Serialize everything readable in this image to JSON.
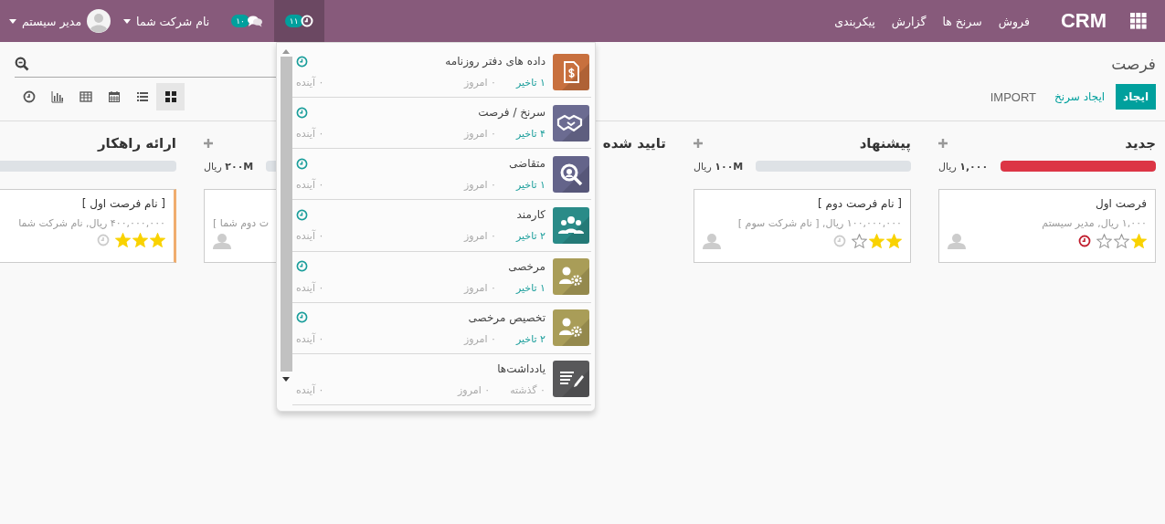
{
  "navbar": {
    "app_name": "CRM",
    "menus": [
      "فروش",
      "سرنخ ها",
      "گزارش",
      "پیکربندی"
    ],
    "user_name": "مدیر سیستم",
    "company": "نام شرکت شما",
    "messages_badge": "۱۰",
    "activities_badge": "۱۱",
    "activities_open": true
  },
  "control_panel": {
    "breadcrumb": "فرصت",
    "buttons": [
      {
        "label": "ایجاد",
        "kind": "primary"
      },
      {
        "label": "ایجاد سرنخ",
        "kind": "link"
      },
      {
        "label": "IMPORT",
        "kind": "secondary"
      }
    ],
    "views": [
      {
        "kind": "kanban",
        "selected": true
      },
      {
        "kind": "list",
        "selected": false
      },
      {
        "kind": "calendar",
        "selected": false
      },
      {
        "kind": "pivot",
        "selected": false
      },
      {
        "kind": "graph",
        "selected": false
      },
      {
        "kind": "activity",
        "selected": false
      }
    ]
  },
  "kanban": {
    "columns": [
      {
        "title": "جدید",
        "add_button": true,
        "total": "**۱,۰۰۰** ریال",
        "level": 1,
        "cards": [
          {
            "title": "فرصت اول",
            "subtitle": "۱,۰۰۰ ریال, مدیر سیستم",
            "stars": 1,
            "overdue": true,
            "avatar": true
          }
        ]
      },
      {
        "title": "پیشنهاد",
        "add_button": true,
        "total": "**۱۰۰M** ریال",
        "level": 0,
        "cards": [
          {
            "title": "[ نام فرصت دوم ]",
            "subtitle": "۱۰۰,۰۰۰,۰۰۰ ریال, [ نام شرکت سوم ]",
            "stars": 2,
            "overdue": false,
            "avatar": true
          }
        ]
      },
      {
        "title": "تایید شده",
        "add_button": false
      },
      {
        "add_button": true,
        "total": "**۲۰۰M** ریال",
        "level": 0,
        "covered": true,
        "cards": [
          {
            "subtitle": "ت دوم شما ]",
            "avatar": true
          }
        ]
      },
      {
        "title": "ارائه راهکار",
        "add_button": false,
        "level": 0,
        "cards": [
          {
            "title": "[ نام فرصت اول ]",
            "subtitle": "۴۰۰,۰۰۰,۰۰۰ ریال, نام شرکت شما",
            "stars": 3,
            "overdue": false,
            "avatar": false,
            "color": "#f0ad6e"
          }
        ]
      }
    ]
  },
  "activity_menu": {
    "items": [
      {
        "title": "داده های دفتر روزنامه",
        "kind": "document",
        "color": "#c8703e",
        "clock": true,
        "counts": [
          {
            "text": "۱ تاخیر",
            "kind": "late"
          },
          {
            "text": "۰ امروز",
            "kind": "today"
          },
          {
            "text": "۰ آینده",
            "kind": "future"
          }
        ]
      },
      {
        "title": "سرنخ / فرصت",
        "kind": "handshake",
        "color": "#6b6b91",
        "clock": true,
        "counts": [
          {
            "text": "۴ تاخیر",
            "kind": "late"
          },
          {
            "text": "۰ امروز",
            "kind": "today"
          },
          {
            "text": "۰ آینده",
            "kind": "future"
          }
        ]
      },
      {
        "title": "متقاضی",
        "kind": "search",
        "color": "#64648a",
        "clock": true,
        "counts": [
          {
            "text": "۱ تاخیر",
            "kind": "late"
          },
          {
            "text": "۰ امروز",
            "kind": "today"
          },
          {
            "text": "۰ آینده",
            "kind": "future"
          }
        ]
      },
      {
        "title": "کارمند",
        "kind": "people",
        "color": "#2a8b88",
        "clock": true,
        "counts": [
          {
            "text": "۲ تاخیر",
            "kind": "late"
          },
          {
            "text": "۰ امروز",
            "kind": "today"
          },
          {
            "text": "۰ آینده",
            "kind": "future"
          }
        ]
      },
      {
        "title": "مرخصی",
        "kind": "leave",
        "color": "#a99d58",
        "clock": true,
        "counts": [
          {
            "text": "۱ تاخیر",
            "kind": "late"
          },
          {
            "text": "۰ امروز",
            "kind": "today"
          },
          {
            "text": "۰ آینده",
            "kind": "future"
          }
        ]
      },
      {
        "title": "تخصیص مرخصی",
        "kind": "leave",
        "color": "#a99d58",
        "clock": true,
        "counts": [
          {
            "text": "۲ تاخیر",
            "kind": "late"
          },
          {
            "text": "۰ امروز",
            "kind": "today"
          },
          {
            "text": "۰ آینده",
            "kind": "future"
          }
        ]
      },
      {
        "title": "یادداشت‌ها",
        "kind": "note",
        "color": "#58585a",
        "clock": false,
        "counts": [
          {
            "text": "۰ گذشته",
            "kind": "past"
          },
          {
            "text": "۰ امروز",
            "kind": "today"
          },
          {
            "text": "۰ آینده",
            "kind": "future"
          }
        ]
      }
    ]
  }
}
